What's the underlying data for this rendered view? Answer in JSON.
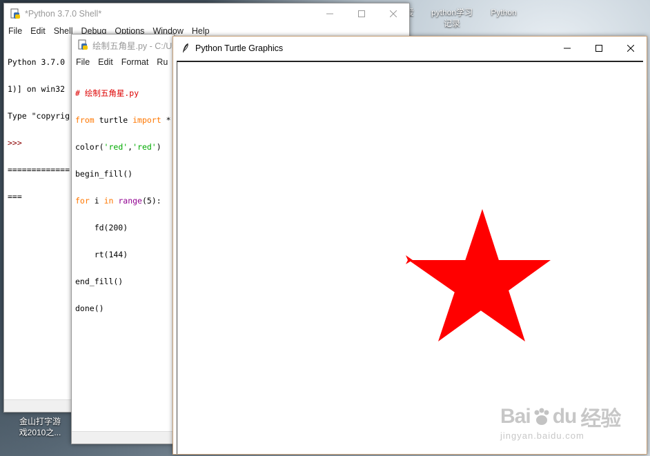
{
  "desktop": {
    "icons": [
      {
        "line1": "python学习",
        "line2": "记录"
      },
      {
        "line1": "Python",
        "line2": ""
      },
      {
        "line1": "金山打字游",
        "line2": "戏2010之..."
      },
      {
        "line1": "爱",
        "line2": ""
      }
    ]
  },
  "shell_window": {
    "title": "*Python 3.7.0 Shell*",
    "menu": [
      "File",
      "Edit",
      "Shell",
      "Debug",
      "Options",
      "Window",
      "Help"
    ],
    "lines": [
      "Python 3.7.0",
      "1)] on win32",
      "Type \"copyrig",
      ">>>",
      "=============",
      "==="
    ]
  },
  "editor_window": {
    "title": "绘制五角星.py - C:/Us",
    "menu": [
      "File",
      "Edit",
      "Format",
      "Ru"
    ],
    "code": {
      "l1": "# 绘制五角星.py",
      "l2_from": "from",
      "l2_mid": " turtle ",
      "l2_import": "import",
      "l2_rest": " *",
      "l3_pre": "color(",
      "l3_s1": "'red'",
      "l3_comma": ",",
      "l3_s2": "'red'",
      "l3_post": ")",
      "l4": "begin_fill()",
      "l5_for": "for",
      "l5_mid": " i ",
      "l5_in": "in",
      "l5_sp": " ",
      "l5_range": "range",
      "l5_post": "(5):",
      "l6": "    fd(200)",
      "l7": "    rt(144)",
      "l8": "end_fill()",
      "l9": "done()"
    }
  },
  "turtle_window": {
    "title": "Python Turtle Graphics",
    "fill_color": "#ff0000"
  },
  "watermark": {
    "brand": "Bai",
    "brand2": "du",
    "brand_cn": "经验",
    "url": "jingyan.baidu.com"
  },
  "icons": {
    "python_file": "python-file-icon",
    "feather": "tk-feather-icon",
    "minimize": "minimize-icon",
    "maximize": "maximize-icon",
    "close": "close-icon"
  }
}
